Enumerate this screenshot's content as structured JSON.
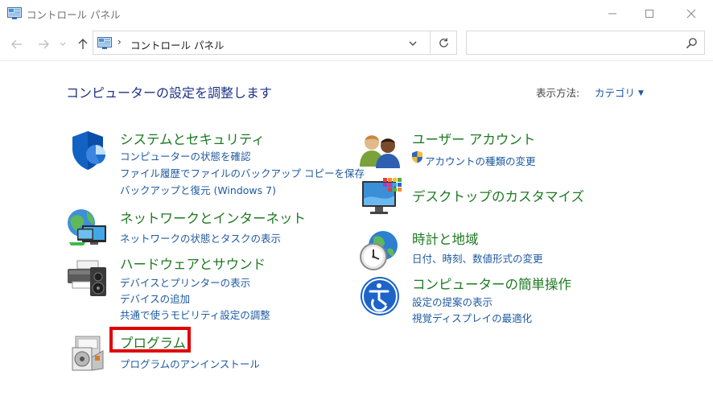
{
  "window": {
    "title": "コントロール パネル",
    "minimize_glyph": "—",
    "maximize_glyph": "☐",
    "close_glyph": "✕"
  },
  "addressbar": {
    "separator": "›",
    "path": "コントロール パネル",
    "search_placeholder": ""
  },
  "main": {
    "title": "コンピューターの設定を調整します",
    "view_label": "表示方法:",
    "view_value": "カテゴリ"
  },
  "categories_left": [
    {
      "title": "システムとセキュリティ",
      "icon": "shield-icon",
      "links": [
        "コンピューターの状態を確認",
        "ファイル履歴でファイルのバックアップ コピーを保存",
        "バックアップと復元 (Windows 7)"
      ]
    },
    {
      "title": "ネットワークとインターネット",
      "icon": "network-globe-icon",
      "links": [
        "ネットワークの状態とタスクの表示"
      ]
    },
    {
      "title": "ハードウェアとサウンド",
      "icon": "printer-speaker-icon",
      "links": [
        "デバイスとプリンターの表示",
        "デバイスの追加",
        "共通で使うモビリティ設定の調整"
      ]
    },
    {
      "title": "プログラム",
      "icon": "programs-icon",
      "links": [
        "プログラムのアンインストール"
      ]
    }
  ],
  "categories_right": [
    {
      "title": "ユーザー アカウント",
      "icon": "user-accounts-icon",
      "links": [
        "アカウントの種類の変更"
      ]
    },
    {
      "title": "デスクトップのカスタマイズ",
      "icon": "desktop-customize-icon",
      "links": []
    },
    {
      "title": "時計と地域",
      "icon": "clock-globe-icon",
      "links": [
        "日付、時刻、数値形式の変更"
      ]
    },
    {
      "title": "コンピューターの簡単操作",
      "icon": "ease-of-access-icon",
      "links": [
        "設定の提案の表示",
        "視覚ディスプレイの最適化"
      ]
    }
  ],
  "colors": {
    "category_title": "#1e7a22",
    "link": "#1e5aa0",
    "page_title": "#1e3287",
    "highlight": "#e00000"
  }
}
